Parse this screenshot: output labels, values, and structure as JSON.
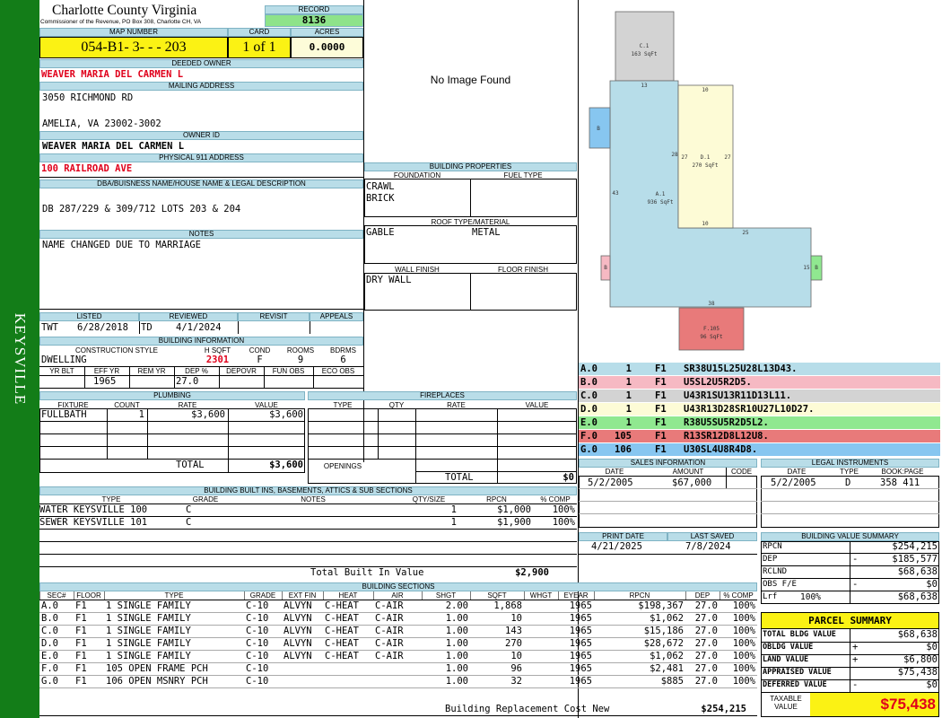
{
  "side_label": "KEYSVILLE",
  "header": {
    "county": "Charlotte County Virginia",
    "commissioner": "Commissioner of the Revenue, PO Box 308, Charlotte CH, VA",
    "record_label": "RECORD",
    "record": "8136"
  },
  "map": {
    "map_label": "MAP NUMBER",
    "map_number": "054-B1- 3- - - 203",
    "card_label": "CARD",
    "card": "1 of 1",
    "acres_label": "ACRES",
    "acres": "0.0000"
  },
  "owner": {
    "deeded_label": "DEEDED OWNER",
    "deeded_owner": "WEAVER MARIA DEL CARMEN L",
    "mailing_label": "MAILING ADDRESS",
    "addr1": "3050 RICHMOND RD",
    "addr2": "AMELIA, VA 23002-3002",
    "owner_id_label": "OWNER ID",
    "owner_id": "WEAVER MARIA DEL CARMEN L",
    "physical_label": "PHYSICAL 911 ADDRESS",
    "physical": "100 RAILROAD AVE"
  },
  "legal": {
    "label": "DBA/BUISNESS NAME/HOUSE NAME & LEGAL DESCRIPTION",
    "text": "DB 287/229 & 309/712 LOTS 203 & 204"
  },
  "notes": {
    "label": "NOTES",
    "text": "NAME CHANGED DUE TO MARRIAGE"
  },
  "image": {
    "text": "No Image Found"
  },
  "props": {
    "label": "BUILDING PROPERTIES",
    "foundation_label": "FOUNDATION",
    "fuel_label": "FUEL TYPE",
    "foundation1": "CRAWL",
    "foundation2": "BRICK",
    "roof_label": "ROOF TYPE/MATERIAL",
    "roof_type": "GABLE",
    "roof_material": "METAL",
    "wall_label": "WALL FINISH",
    "floor_label": "FLOOR FINISH",
    "wall": "DRY WALL"
  },
  "listing": {
    "listed_label": "LISTED",
    "reviewed_label": "REVIEWED",
    "revisit_label": "REVISIT",
    "appeals_label": "APPEALS",
    "listed_by": "TWT",
    "listed_date": "6/28/2018",
    "reviewed_by": "TD",
    "reviewed_date": "4/1/2024"
  },
  "bldg_info": {
    "label": "BUILDING INFORMATION",
    "style_label": "CONSTRUCTION STYLE",
    "hsqft_label": "H SQFT",
    "cond_label": "COND",
    "rooms_label": "ROOMS",
    "bdrms_label": "BDRMS",
    "style": "DWELLING",
    "hsqft": "2301",
    "cond": "F",
    "rooms": "9",
    "bdrms": "6",
    "yrblt_label": "YR BLT",
    "effyr_label": "EFF YR",
    "remyr_label": "REM YR",
    "dep_label": "DEP %",
    "depovr_label": "DEPOVR",
    "funobs_label": "FUN OBS",
    "ecoobs_label": "ECO OBS",
    "effyr": "1965",
    "dep": "27.0"
  },
  "plumbing": {
    "label": "PLUMBING",
    "headers": [
      "FIXTURE",
      "COUNT",
      "RATE",
      "VALUE"
    ],
    "rows": [
      [
        "FULLBATH",
        "1",
        "$3,600",
        "$3,600"
      ]
    ],
    "total_label": "TOTAL",
    "total": "$3,600"
  },
  "fireplaces": {
    "label": "FIREPLACES",
    "headers": [
      "TYPE",
      "QTY",
      "RATE",
      "VALUE"
    ],
    "openings_label": "OPENINGS",
    "total_label": "TOTAL",
    "total": "$0"
  },
  "builtins": {
    "label": "BUILDING BUILT INS, BASEMENTS, ATTICS & SUB SECTIONS",
    "headers": [
      "TYPE",
      "GRADE",
      "NOTES",
      "QTY/SIZE",
      "RPCN",
      "% COMP"
    ],
    "rows": [
      [
        "100 WATER KEYSVILLE",
        "C",
        "",
        "1",
        "$1,000",
        "100%"
      ],
      [
        "101 SEWER KEYSVILLE",
        "C",
        "",
        "1",
        "$1,900",
        "100%"
      ]
    ],
    "total_label": "Total Built In Value",
    "total": "$2,900"
  },
  "sketch": {
    "areas": [
      {
        "label": "C.1",
        "sqft": "163 SqFt"
      },
      {
        "label": "A.1",
        "sqft": "936 SqFt"
      },
      {
        "label": "D.1",
        "sqft": "270 SqFt"
      },
      {
        "label": "F.105",
        "sqft": "96 SqFt"
      },
      {
        "label": "B",
        "sqft": ""
      },
      {
        "label": "B",
        "sqft": ""
      },
      {
        "label": "B",
        "sqft": ""
      }
    ],
    "dims": [
      "13",
      "10",
      "28",
      "27",
      "27",
      "43",
      "10",
      "25",
      "15",
      "38"
    ]
  },
  "sections_codes": [
    {
      "code": "A.0",
      "n": "1",
      "f": "F1",
      "path": "SR38U15L25U28L13D43.",
      "color": "#b7dde9"
    },
    {
      "code": "B.0",
      "n": "1",
      "f": "F1",
      "path": "U5SL2U5R2D5.",
      "color": "#f6b9c3"
    },
    {
      "code": "C.0",
      "n": "1",
      "f": "F1",
      "path": "U43R1SU13R11D13L11.",
      "color": "#d3d3d3"
    },
    {
      "code": "D.0",
      "n": "1",
      "f": "F1",
      "path": "U43R13D28SR10U27L10D27.",
      "color": "#fdfbd6"
    },
    {
      "code": "E.0",
      "n": "1",
      "f": "F1",
      "path": "R38U5SU5R2D5L2.",
      "color": "#90e890"
    },
    {
      "code": "F.0",
      "n": "105",
      "f": "F1",
      "path": "R13SR12D8L12U8.",
      "color": "#e87a7a"
    },
    {
      "code": "G.0",
      "n": "106",
      "f": "F1",
      "path": "U30SL4U8R4D8.",
      "color": "#87c6f0"
    }
  ],
  "sales": {
    "label": "SALES INFORMATION",
    "headers": [
      "DATE",
      "AMOUNT",
      "CODE"
    ],
    "rows": [
      [
        "5/2/2005",
        "$67,000",
        ""
      ]
    ]
  },
  "legal_inst": {
    "label": "LEGAL INSTRUMENTS",
    "headers": [
      "DATE",
      "TYPE",
      "BOOK:PAGE"
    ],
    "rows": [
      [
        "5/2/2005",
        "D",
        "358 411"
      ]
    ]
  },
  "dates": {
    "print_label": "PRINT DATE",
    "saved_label": "LAST SAVED",
    "print_date": "4/21/2025",
    "last_saved": "7/8/2024"
  },
  "value_summary": {
    "label": "BUILDING VALUE SUMMARY",
    "rows": [
      {
        "label": "RPCN",
        "sign": "",
        "value": "$254,215",
        "pct": ""
      },
      {
        "label": "DEP",
        "sign": "-",
        "value": "$185,577",
        "pct": ""
      },
      {
        "label": "RCLND",
        "sign": "",
        "value": "$68,638",
        "pct": ""
      },
      {
        "label": "OBS F/E",
        "sign": "-",
        "value": "$0",
        "pct": ""
      },
      {
        "label": "Lrf",
        "sign": "",
        "value": "$68,638",
        "pct": "100%"
      }
    ]
  },
  "parcel": {
    "title": "PARCEL SUMMARY",
    "rows": [
      {
        "label": "TOTAL BLDG VALUE",
        "sign": "",
        "value": "$68,638"
      },
      {
        "label": "OBLDG VALUE",
        "sign": "+",
        "value": "$0"
      },
      {
        "label": "LAND VALUE",
        "sign": "+",
        "value": "$6,800"
      },
      {
        "label": "APPRAISED VALUE",
        "sign": "",
        "value": "$75,438"
      },
      {
        "label": "DEFERRED VALUE",
        "sign": "-",
        "value": "$0"
      }
    ],
    "taxable_label": "TAXABLE VALUE",
    "taxable": "$75,438"
  },
  "sections": {
    "label": "BUILDING SECTIONS",
    "headers": [
      "SEC#",
      "FLOOR",
      "TYPE",
      "GRADE",
      "EXT FIN",
      "HEAT",
      "AIR",
      "SHGT",
      "SQFT",
      "WHGT",
      "EYEAR",
      "RPCN",
      "DEP",
      "% COMP"
    ],
    "rows": [
      [
        "A.0",
        "F1",
        "1 SINGLE FAMILY",
        "C-10",
        "ALVYN",
        "C-HEAT",
        "C-AIR",
        "2.00",
        "1,868",
        "",
        "1965",
        "$198,367",
        "27.0",
        "100%"
      ],
      [
        "B.0",
        "F1",
        "1 SINGLE FAMILY",
        "C-10",
        "ALVYN",
        "C-HEAT",
        "C-AIR",
        "1.00",
        "10",
        "",
        "1965",
        "$1,062",
        "27.0",
        "100%"
      ],
      [
        "C.0",
        "F1",
        "1 SINGLE FAMILY",
        "C-10",
        "ALVYN",
        "C-HEAT",
        "C-AIR",
        "1.00",
        "143",
        "",
        "1965",
        "$15,186",
        "27.0",
        "100%"
      ],
      [
        "D.0",
        "F1",
        "1 SINGLE FAMILY",
        "C-10",
        "ALVYN",
        "C-HEAT",
        "C-AIR",
        "1.00",
        "270",
        "",
        "1965",
        "$28,672",
        "27.0",
        "100%"
      ],
      [
        "E.0",
        "F1",
        "1 SINGLE FAMILY",
        "C-10",
        "ALVYN",
        "C-HEAT",
        "C-AIR",
        "1.00",
        "10",
        "",
        "1965",
        "$1,062",
        "27.0",
        "100%"
      ],
      [
        "F.0",
        "F1",
        "105 OPEN FRAME PCH",
        "C-10",
        "",
        "",
        "",
        "1.00",
        "96",
        "",
        "1965",
        "$2,481",
        "27.0",
        "100%"
      ],
      [
        "G.0",
        "F1",
        "106 OPEN MSNRY PCH",
        "C-10",
        "",
        "",
        "",
        "1.00",
        "32",
        "",
        "1965",
        "$885",
        "27.0",
        "100%"
      ]
    ],
    "total_label": "Building Replacement Cost New",
    "total": "$254,215"
  }
}
